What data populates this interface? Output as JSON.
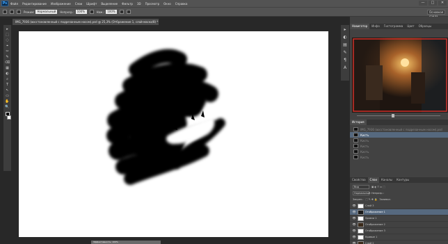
{
  "app": {
    "logo": "Ps",
    "menu": [
      "Файл",
      "Редактирование",
      "Изображение",
      "Слои",
      "Шрифт",
      "Выделение",
      "Фильтр",
      "3D",
      "Просмотр",
      "Окно",
      "Справка"
    ],
    "window_controls": [
      "—",
      "□",
      "✕"
    ]
  },
  "options_bar": {
    "mode_label": "Режим:",
    "mode_value": "Нормальный",
    "opacity_label": "Непрозр.:",
    "opacity_value": "100%",
    "pressure_label": "Наж.:",
    "pressure_value": "100%",
    "workspace": "Основная среда"
  },
  "document": {
    "tab_title": "IMG_7936 (восстановленный с подрезанным носом).psd @ 25,3% (Отбражение 1, слой-маска/8) *",
    "status": "Эффективность: 100%"
  },
  "tools": [
    "▸",
    "⬚",
    "◌",
    "⌖",
    "✂",
    "✎",
    "⌫",
    "▦",
    "◐",
    "⌕",
    "T",
    "↖",
    "▭",
    "✋",
    "🔍"
  ],
  "strip_icons": [
    "▸",
    "◐",
    "▤",
    "✎",
    "¶",
    "A"
  ],
  "panels": {
    "top_tabs": [
      "Навигатор",
      "Инфо",
      "Гистограмма",
      "Цвет",
      "Образцы"
    ],
    "history_tabs": [
      "История"
    ],
    "history": [
      {
        "label": "IMG_7936 (восстановленный с подрезанным носом).psd",
        "state": "dim"
      },
      {
        "label": "Кисть",
        "state": "selected"
      },
      {
        "label": "Кисть",
        "state": "dim"
      },
      {
        "label": "Кисть",
        "state": "dim"
      },
      {
        "label": "Кисть",
        "state": "dim"
      },
      {
        "label": "Кисть",
        "state": "dim"
      }
    ],
    "layers_tabs": [
      "Свойства",
      "Слои",
      "Каналы",
      "Контуры"
    ],
    "kind_filter": "Вид",
    "blend_mode": "Нормальный",
    "opacity_label": "Непрозр.:",
    "lock_label": "Закреп.:",
    "fill_label": "Заливка:",
    "layers": [
      {
        "name": "Слой 3",
        "thumb": "white",
        "selected": false
      },
      {
        "name": "Отображение 1",
        "thumb": "dark",
        "selected": true
      },
      {
        "name": "Уровни 1",
        "thumb": "white",
        "selected": false
      },
      {
        "name": "Отображение 2",
        "thumb": "photo",
        "selected": false
      },
      {
        "name": "Отображение 3",
        "thumb": "white",
        "selected": false
      },
      {
        "name": "Кривые 1",
        "thumb": "white",
        "selected": false
      },
      {
        "name": "Слой 2",
        "thumb": "photo",
        "selected": false
      }
    ]
  },
  "colors": {
    "accent": "#56697f",
    "canvas": "#ffffff",
    "paint": "#000000"
  }
}
